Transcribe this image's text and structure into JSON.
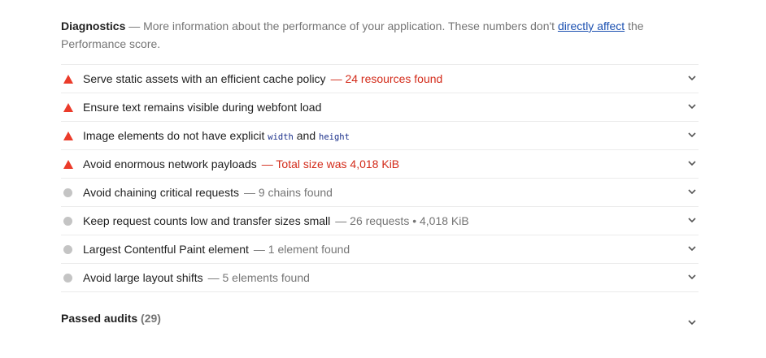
{
  "header": {
    "title": "Diagnostics",
    "desc_before": " — More information about the performance of your application. These numbers don't ",
    "link": "directly affect",
    "desc_after": " the Performance score."
  },
  "audits": [
    {
      "status": "fail",
      "icon": "fail-triangle-icon",
      "title": "Serve static assets with an efficient cache policy",
      "display": "— 24 resources found"
    },
    {
      "status": "fail",
      "icon": "fail-triangle-icon",
      "title": "Ensure text remains visible during webfont load",
      "display": ""
    },
    {
      "status": "fail",
      "icon": "fail-triangle-icon",
      "title_parts": [
        "Image elements do not have explicit ",
        "width",
        " and ",
        "height"
      ],
      "display": ""
    },
    {
      "status": "fail",
      "icon": "fail-triangle-icon",
      "title": "Avoid enormous network payloads",
      "display": "— Total size was 4,018 KiB"
    },
    {
      "status": "info",
      "icon": "info-circle-icon",
      "title": "Avoid chaining critical requests",
      "display": "— 9 chains found"
    },
    {
      "status": "info",
      "icon": "info-circle-icon",
      "title": "Keep request counts low and transfer sizes small",
      "display": "— 26 requests • 4,018 KiB"
    },
    {
      "status": "info",
      "icon": "info-circle-icon",
      "title": "Largest Contentful Paint element",
      "display": "— 1 element found"
    },
    {
      "status": "info",
      "icon": "info-circle-icon",
      "title": "Avoid large layout shifts",
      "display": "— 5 elements found"
    }
  ],
  "passed": {
    "title": "Passed audits",
    "count": "(29)"
  },
  "colors": {
    "fail": "#eb3b2a",
    "info": "#c4c4c4",
    "link": "#1a4fb0"
  }
}
